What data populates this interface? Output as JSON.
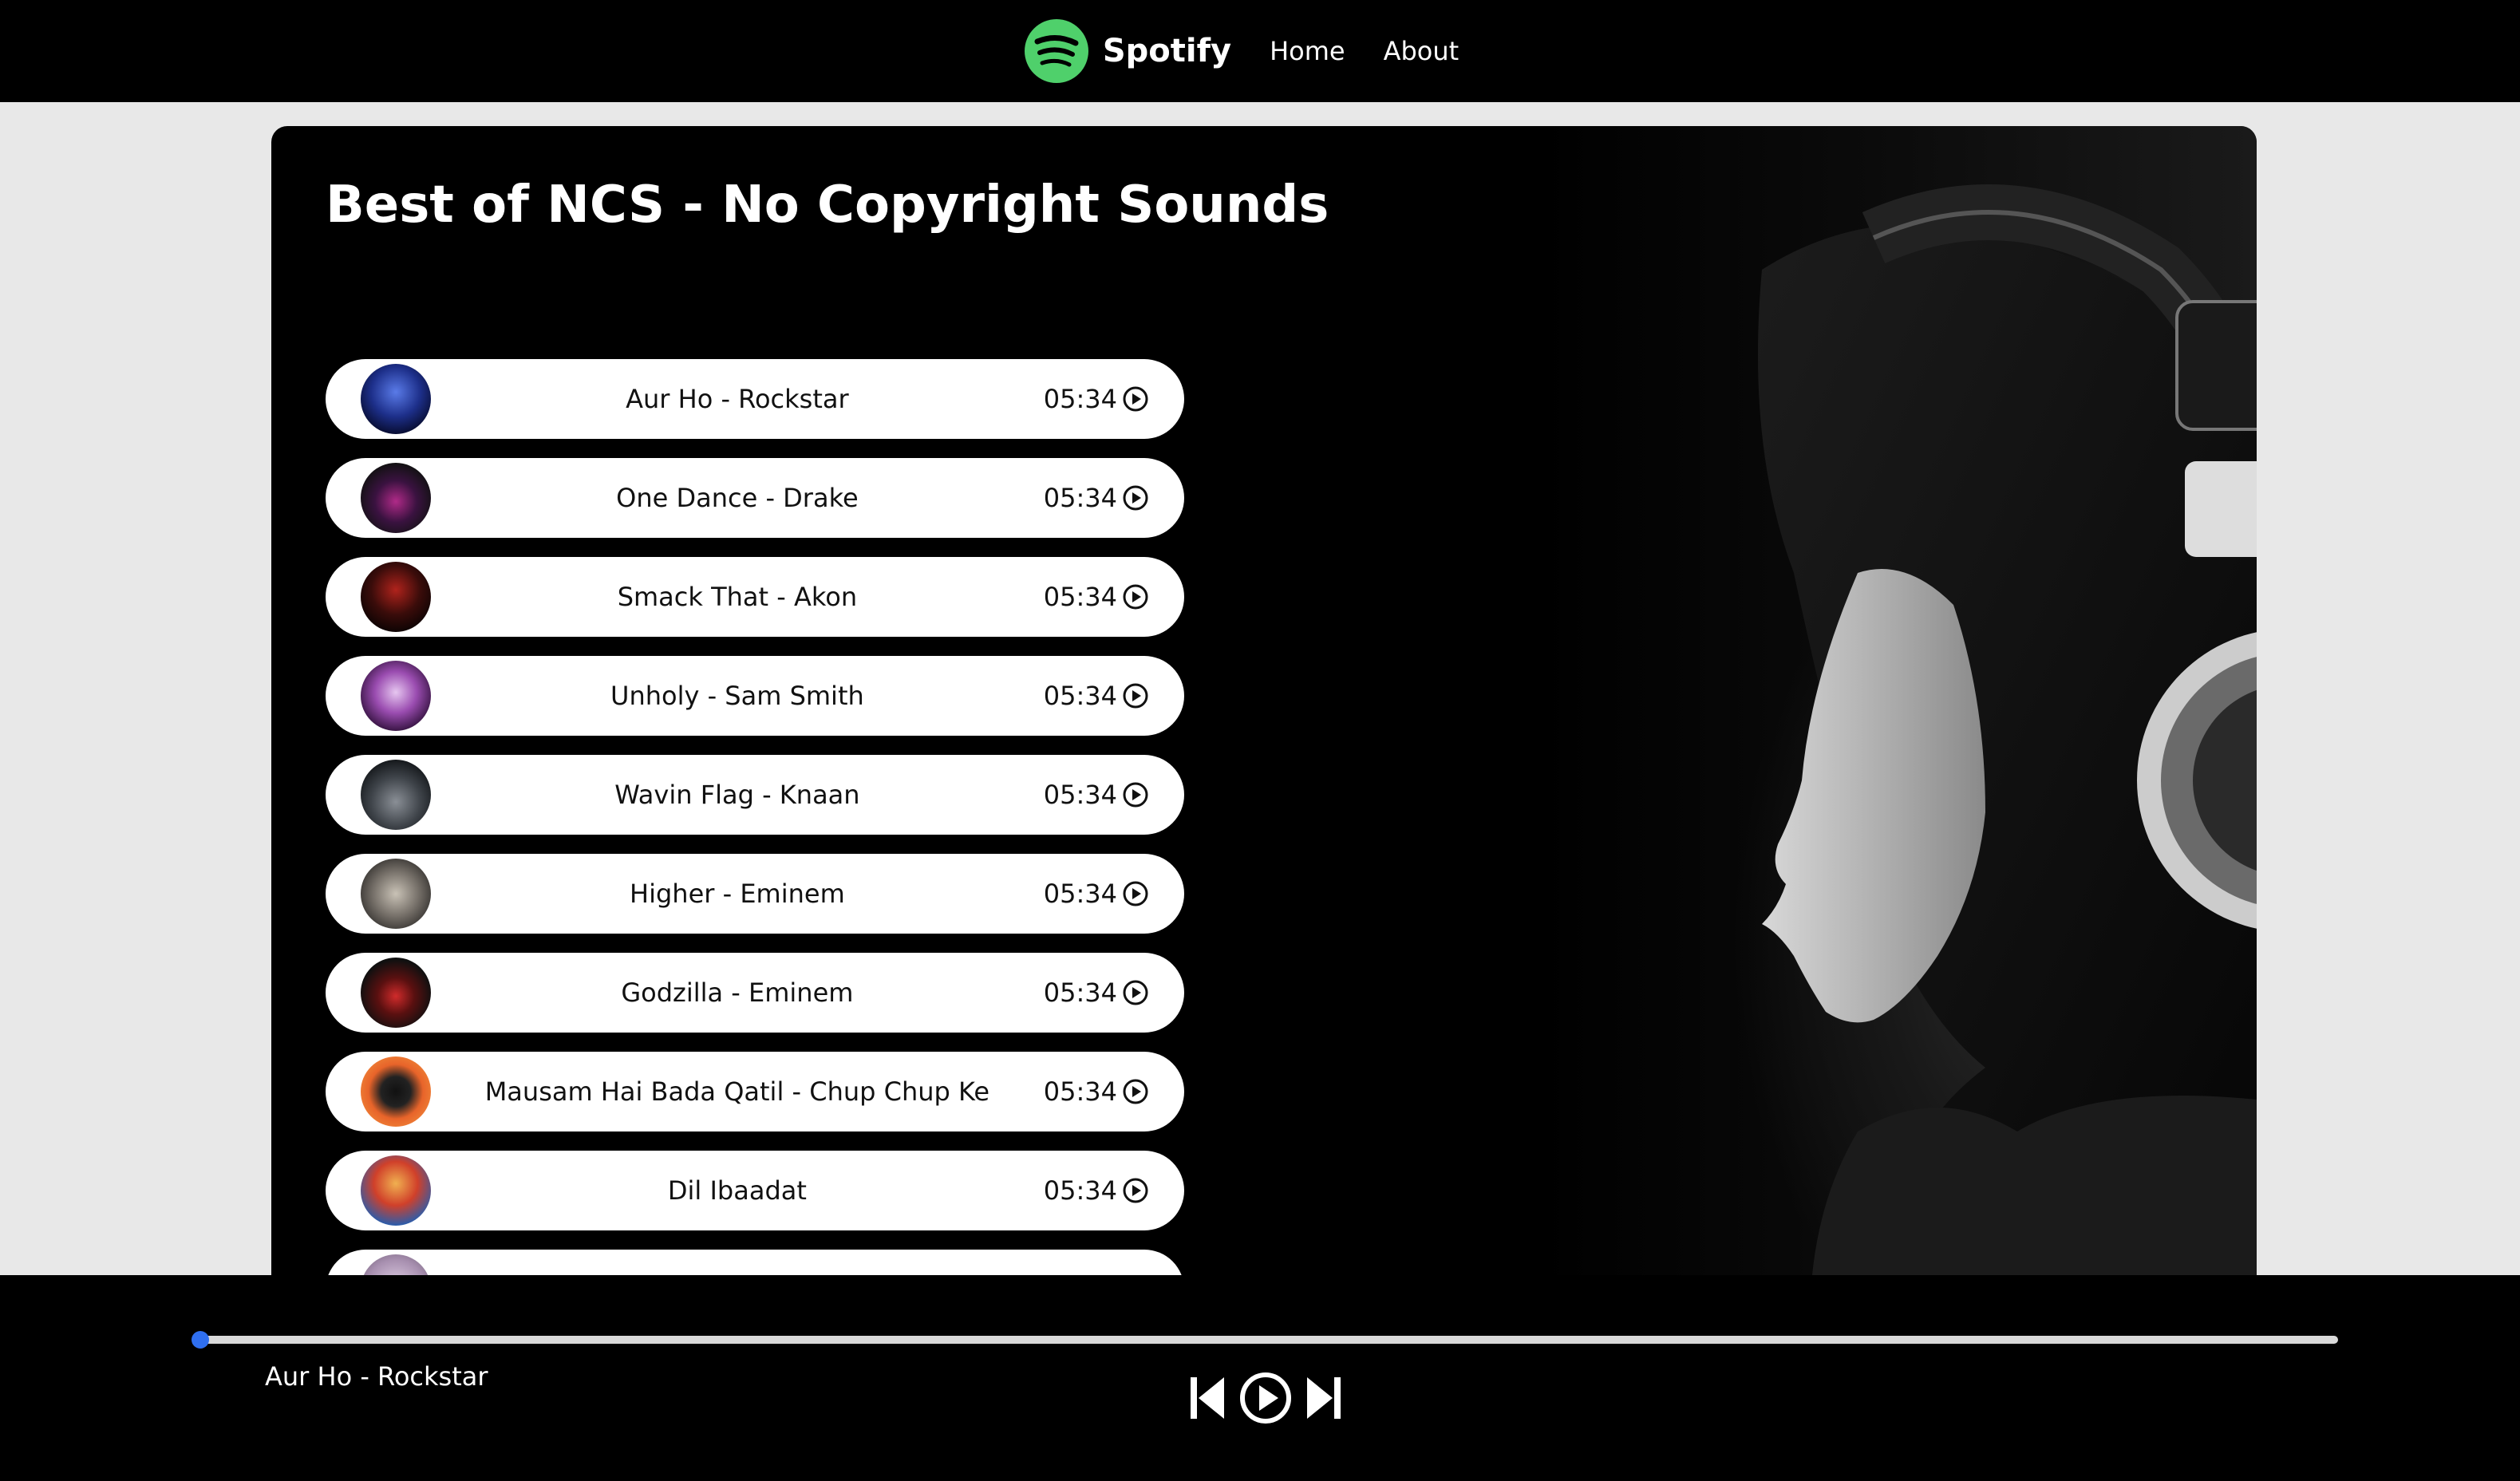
{
  "nav": {
    "brand": "Spotify",
    "links": [
      "Home",
      "About"
    ],
    "logo_color": "#1DB954"
  },
  "playlist": {
    "title": "Best of NCS - No Copyright Sounds",
    "songs": [
      {
        "name": "Aur Ho - Rockstar",
        "duration": "05:34"
      },
      {
        "name": "One Dance - Drake",
        "duration": "05:34"
      },
      {
        "name": "Smack That - Akon",
        "duration": "05:34"
      },
      {
        "name": "Unholy - Sam Smith",
        "duration": "05:34"
      },
      {
        "name": "Wavin Flag - Knaan",
        "duration": "05:34"
      },
      {
        "name": "Higher - Eminem",
        "duration": "05:34"
      },
      {
        "name": "Godzilla - Eminem",
        "duration": "05:34"
      },
      {
        "name": "Mausam Hai Bada Qatil - Chup Chup Ke",
        "duration": "05:34"
      },
      {
        "name": "Dil Ibaadat",
        "duration": "05:34"
      }
    ]
  },
  "player": {
    "current_song": "Aur Ho - Rockstar",
    "progress": 0,
    "thumb_color": "#2f6ff0",
    "controls": [
      "previous-icon",
      "play-icon",
      "next-icon"
    ]
  }
}
